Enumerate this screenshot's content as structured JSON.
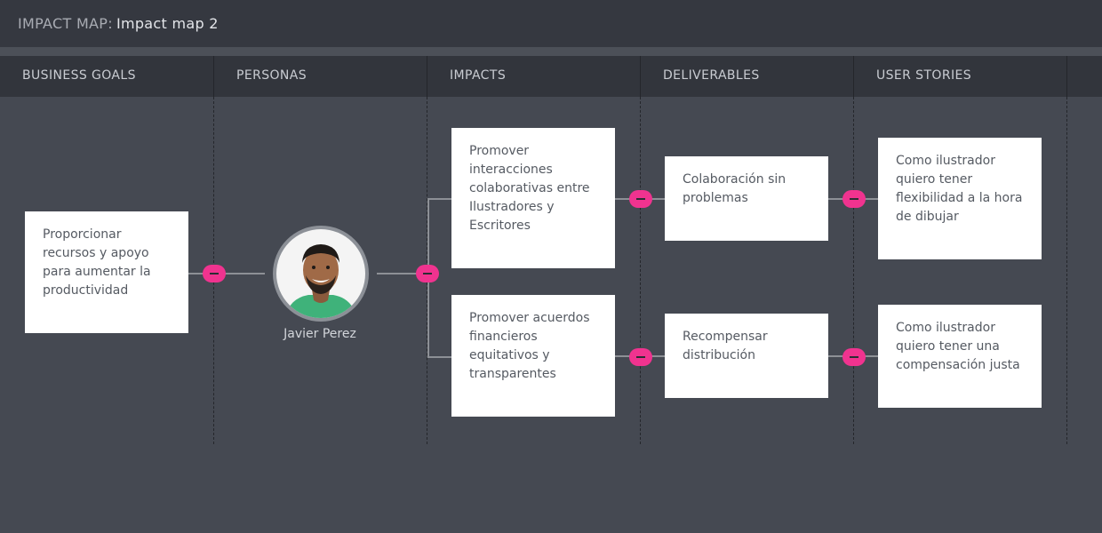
{
  "header": {
    "label": "IMPACT MAP:",
    "title": "Impact map 2"
  },
  "columns": [
    "BUSINESS GOALS",
    "PERSONAS",
    "IMPACTS",
    "DELIVERABLES",
    "USER STORIES"
  ],
  "business_goal": "Proporcionar recursos y apoyo para aumentar la productividad",
  "persona": {
    "name": "Javier Perez"
  },
  "impacts": [
    "Promover interacciones colaborativas entre Ilustradores y Escritores",
    "Promover acuerdos financieros equitativos y transparentes"
  ],
  "deliverables": [
    "Colaboración sin problemas",
    "Recompensar distribución"
  ],
  "user_stories": [
    "Como ilustrador quiero tener flexibilidad a la hora de dibujar",
    "Como ilustrador quiero tener una compensación justa"
  ],
  "colors": {
    "toggle": "#f0338f",
    "background": "#454952",
    "card": "#ffffff"
  }
}
